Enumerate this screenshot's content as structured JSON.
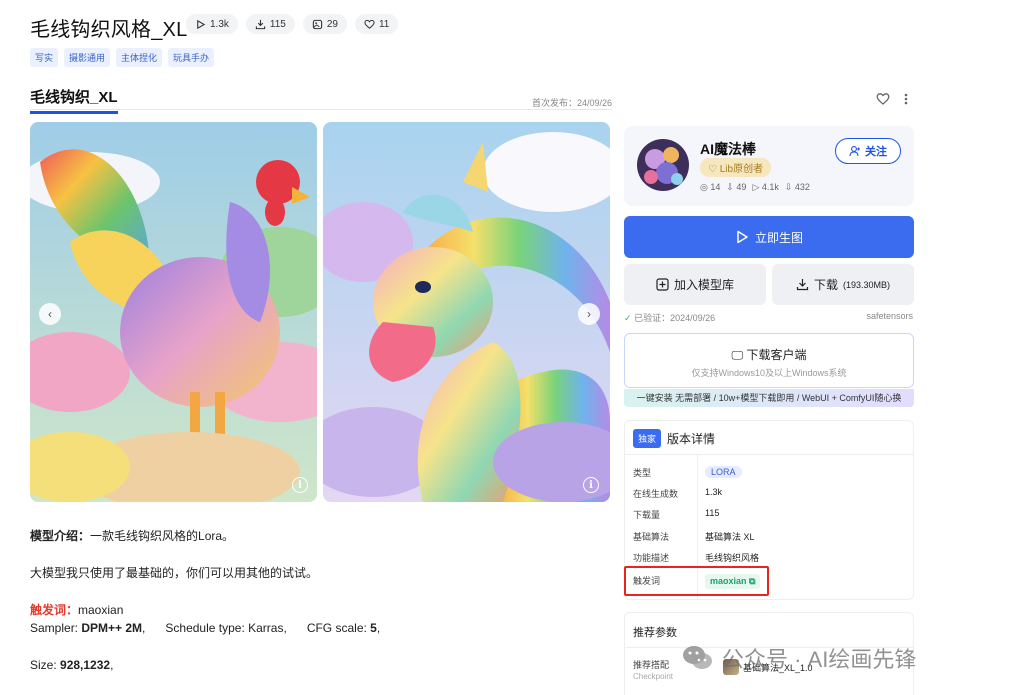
{
  "header": {
    "title": "毛线钩织风格_XL",
    "stats": [
      {
        "icon": "play-icon",
        "value": "1.3k"
      },
      {
        "icon": "download-icon",
        "value": "115"
      },
      {
        "icon": "image-icon",
        "value": "29"
      },
      {
        "icon": "heart-icon",
        "value": "11"
      }
    ],
    "tags": [
      "写实",
      "摄影通用",
      "主体捏化",
      "玩具手办"
    ]
  },
  "tab": {
    "active_label": "毛线钩织_XL",
    "publish_date": "首次发布：24/09/26"
  },
  "gallery": {
    "prev_label": "‹",
    "next_label": "›",
    "info_label": "i"
  },
  "description": {
    "intro_label": "模型介绍：",
    "intro_text": "一款毛线钩织风格的Lora。",
    "note": "大模型我只使用了最基础的，你们可以用其他的试试。",
    "trigger_label": "触发词：",
    "trigger_value": "maoxian",
    "sampler_label": "Sampler: ",
    "sampler_value": "DPM++ 2M",
    "schedule_label": "Schedule type: Karras,",
    "cfg_label": "CFG scale: ",
    "cfg_value": "5",
    "size_label": "Size: ",
    "size_value": "928,1232"
  },
  "author": {
    "name": "AI魔法棒",
    "badge": "Lib原创者",
    "stats": [
      "14",
      "49",
      "4.1k",
      "432"
    ],
    "follow_label": "关注"
  },
  "actions": {
    "generate_label": "立即生图",
    "add_label": "加入模型库",
    "download_label": "下载",
    "download_size": "(193.30MB)",
    "verified": "已验证：2024/09/26",
    "format": "safetensors"
  },
  "client": {
    "title": "下载客户端",
    "subtitle": "仅支持Windows10及以上Windows系统",
    "banner": "一键安装 无需部署 / 10w+模型下载即用 / WebUI + ComfyUI随心换"
  },
  "version": {
    "exclusive_label": "独家",
    "title": "版本详情",
    "rows": [
      {
        "key": "类型",
        "value": "LORA"
      },
      {
        "key": "在线生成数",
        "value": "1.3k"
      },
      {
        "key": "下载量",
        "value": "115"
      },
      {
        "key": "基础算法",
        "value": "基础算法 XL"
      },
      {
        "key": "功能描述",
        "value": "毛线钩织风格"
      },
      {
        "key": "触发词",
        "value": "maoxian"
      }
    ]
  },
  "params": {
    "title": "推荐参数",
    "key": "推荐搭配",
    "key_sub": "Checkpoint",
    "value": "基础算法_XL_1.0"
  },
  "watermark": "公众号 · AI绘画先锋",
  "colors": {
    "accent": "#3b6cf0",
    "highlight_box": "#e8261e",
    "trigger_green": "#1ba36a"
  }
}
